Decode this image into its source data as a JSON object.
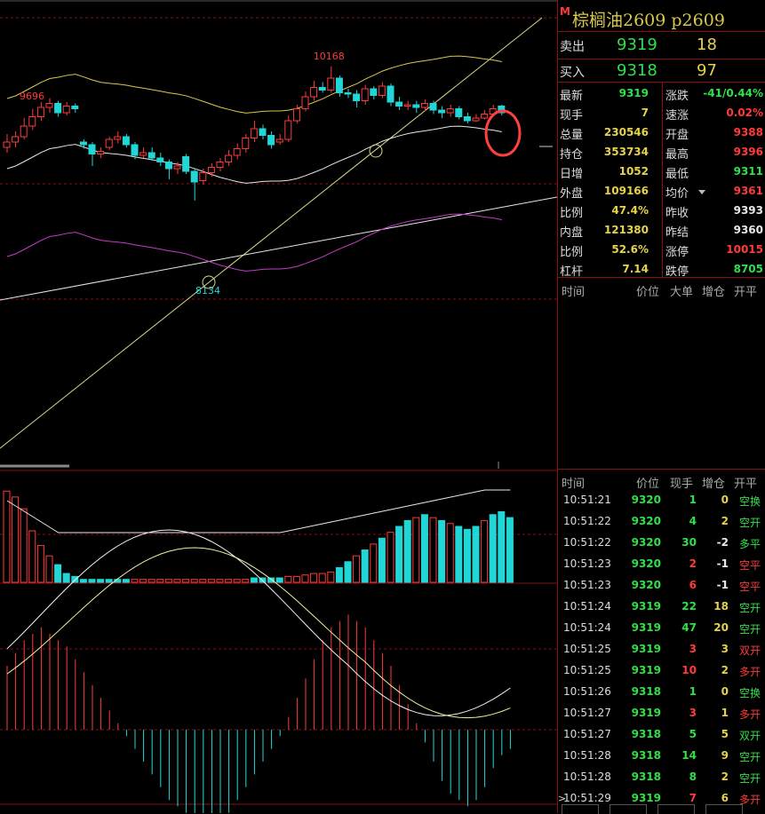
{
  "instrument": {
    "badge": "M",
    "title": "棕榈油2609  p2609"
  },
  "quote": {
    "sell_label": "卖出",
    "sell_price": "9319",
    "sell_vol": "18",
    "buy_label": "买入",
    "buy_price": "9318",
    "buy_vol": "97"
  },
  "stats": [
    {
      "l1": "最新",
      "v1": "9319",
      "c1": "green",
      "l2": "涨跌",
      "v2": "-41/0.44%",
      "c2": "green"
    },
    {
      "l1": "现手",
      "v1": "7",
      "c1": "yellow",
      "l2": "速涨",
      "v2": "0.02%",
      "c2": "red"
    },
    {
      "l1": "总量",
      "v1": "230546",
      "c1": "yellow",
      "l2": "开盘",
      "v2": "9388",
      "c2": "red"
    },
    {
      "l1": "持仓",
      "v1": "353734",
      "c1": "yellow",
      "l2": "最高",
      "v2": "9396",
      "c2": "red"
    },
    {
      "l1": "日增",
      "v1": "1052",
      "c1": "yellow",
      "l2": "最低",
      "v2": "9311",
      "c2": "green"
    },
    {
      "l1": "外盘",
      "v1": "109166",
      "c1": "yellow",
      "l2": "均价",
      "v2": "9361",
      "c2": "red"
    },
    {
      "l1": "比例",
      "v1": "47.4%",
      "c1": "yellow",
      "l2": "昨收",
      "v2": "9393",
      "c2": "white"
    },
    {
      "l1": "内盘",
      "v1": "121380",
      "c1": "yellow",
      "l2": "昨结",
      "v2": "9360",
      "c2": "white"
    },
    {
      "l1": "比例",
      "v1": "52.6%",
      "c1": "yellow",
      "l2": "涨停",
      "v2": "10015",
      "c2": "red"
    },
    {
      "l1": "杠杆",
      "v1": "7.14",
      "c1": "yellow",
      "l2": "跌停",
      "v2": "8705",
      "c2": "green"
    }
  ],
  "big_order_header": {
    "time": "时间",
    "price": "价位",
    "big": "大单",
    "oi": "增仓",
    "type": "开平"
  },
  "tick_header": {
    "time": "时间",
    "price": "价位",
    "vol": "现手",
    "oi": "增仓",
    "type": "开平"
  },
  "ticks": [
    {
      "time": "10:51:21",
      "price": "9320",
      "vol": "1",
      "oi": "0",
      "type": "空换",
      "pc": "green",
      "vc": "green",
      "oc": "yellow",
      "tc": "green"
    },
    {
      "time": "10:51:22",
      "price": "9320",
      "vol": "4",
      "oi": "2",
      "type": "空开",
      "pc": "green",
      "vc": "green",
      "oc": "yellow",
      "tc": "green"
    },
    {
      "time": "10:51:22",
      "price": "9320",
      "vol": "30",
      "oi": "-2",
      "type": "多平",
      "pc": "green",
      "vc": "green",
      "oc": "white",
      "tc": "green"
    },
    {
      "time": "10:51:23",
      "price": "9320",
      "vol": "2",
      "oi": "-1",
      "type": "空平",
      "pc": "green",
      "vc": "red",
      "oc": "white",
      "tc": "red"
    },
    {
      "time": "10:51:23",
      "price": "9320",
      "vol": "6",
      "oi": "-1",
      "type": "空平",
      "pc": "green",
      "vc": "red",
      "oc": "white",
      "tc": "red"
    },
    {
      "time": "10:51:24",
      "price": "9319",
      "vol": "22",
      "oi": "18",
      "type": "空开",
      "pc": "green",
      "vc": "green",
      "oc": "yellow",
      "tc": "green"
    },
    {
      "time": "10:51:24",
      "price": "9319",
      "vol": "47",
      "oi": "20",
      "type": "空开",
      "pc": "green",
      "vc": "green",
      "oc": "yellow",
      "tc": "green"
    },
    {
      "time": "10:51:25",
      "price": "9319",
      "vol": "3",
      "oi": "3",
      "type": "双开",
      "pc": "green",
      "vc": "red",
      "oc": "yellow",
      "tc": "red"
    },
    {
      "time": "10:51:25",
      "price": "9319",
      "vol": "10",
      "oi": "2",
      "type": "多开",
      "pc": "green",
      "vc": "red",
      "oc": "yellow",
      "tc": "red"
    },
    {
      "time": "10:51:26",
      "price": "9318",
      "vol": "1",
      "oi": "0",
      "type": "空换",
      "pc": "green",
      "vc": "green",
      "oc": "yellow",
      "tc": "green"
    },
    {
      "time": "10:51:27",
      "price": "9319",
      "vol": "3",
      "oi": "1",
      "type": "多开",
      "pc": "green",
      "vc": "red",
      "oc": "yellow",
      "tc": "red"
    },
    {
      "time": "10:51:27",
      "price": "9318",
      "vol": "5",
      "oi": "5",
      "type": "双开",
      "pc": "green",
      "vc": "green",
      "oc": "yellow",
      "tc": "green"
    },
    {
      "time": "10:51:28",
      "price": "9318",
      "vol": "14",
      "oi": "9",
      "type": "空开",
      "pc": "green",
      "vc": "green",
      "oc": "yellow",
      "tc": "green"
    },
    {
      "time": "10:51:28",
      "price": "9318",
      "vol": "8",
      "oi": "2",
      "type": "空开",
      "pc": "green",
      "vc": "green",
      "oc": "yellow",
      "tc": "green"
    },
    {
      "time": "10:51:29",
      "price": "9319",
      "vol": "7",
      "oi": "6",
      "type": "多开",
      "pc": "green",
      "vc": "red",
      "oc": "yellow",
      "tc": "red"
    }
  ],
  "colors": {
    "up": "#ff3a3a",
    "down": "#21d6d6",
    "grid": "#8a1010",
    "ma": "#e8e8e8",
    "boll_mid": "#d8c94a",
    "boll_low": "#c43cc4"
  },
  "chart_data": {
    "type": "candlestick",
    "annotations": {
      "high_label": "10168",
      "left_high_label": "9696",
      "low_label": "8134"
    },
    "candles": [
      {
        "o": 9560,
        "c": 9600,
        "h": 9660,
        "l": 9520
      },
      {
        "o": 9600,
        "c": 9640,
        "h": 9680,
        "l": 9560
      },
      {
        "o": 9640,
        "c": 9720,
        "h": 9780,
        "l": 9620
      },
      {
        "o": 9720,
        "c": 9790,
        "h": 9850,
        "l": 9690
      },
      {
        "o": 9790,
        "c": 9860,
        "h": 9900,
        "l": 9760
      },
      {
        "o": 9860,
        "c": 9890,
        "h": 9930,
        "l": 9820
      },
      {
        "o": 9890,
        "c": 9820,
        "h": 9910,
        "l": 9790
      },
      {
        "o": 9820,
        "c": 9870,
        "h": 9900,
        "l": 9800
      },
      {
        "o": 9870,
        "c": 9850,
        "h": 9890,
        "l": 9820
      },
      {
        "o": 9600,
        "c": 9580,
        "h": 9620,
        "l": 9550
      },
      {
        "o": 9580,
        "c": 9510,
        "h": 9600,
        "l": 9420
      },
      {
        "o": 9510,
        "c": 9530,
        "h": 9560,
        "l": 9480
      },
      {
        "o": 9560,
        "c": 9620,
        "h": 9640,
        "l": 9540
      },
      {
        "o": 9620,
        "c": 9640,
        "h": 9680,
        "l": 9590
      },
      {
        "o": 9640,
        "c": 9580,
        "h": 9660,
        "l": 9560
      },
      {
        "o": 9580,
        "c": 9500,
        "h": 9600,
        "l": 9470
      },
      {
        "o": 9500,
        "c": 9520,
        "h": 9560,
        "l": 9480
      },
      {
        "o": 9520,
        "c": 9480,
        "h": 9560,
        "l": 9460
      },
      {
        "o": 9480,
        "c": 9450,
        "h": 9520,
        "l": 9420
      },
      {
        "o": 9450,
        "c": 9400,
        "h": 9470,
        "l": 9320
      },
      {
        "o": 9400,
        "c": 9420,
        "h": 9450,
        "l": 9360
      },
      {
        "o": 9490,
        "c": 9380,
        "h": 9510,
        "l": 9360
      },
      {
        "o": 9380,
        "c": 9300,
        "h": 9400,
        "l": 9160
      },
      {
        "o": 9310,
        "c": 9370,
        "h": 9400,
        "l": 9280
      },
      {
        "o": 9370,
        "c": 9410,
        "h": 9440,
        "l": 9340
      },
      {
        "o": 9410,
        "c": 9450,
        "h": 9480,
        "l": 9380
      },
      {
        "o": 9450,
        "c": 9500,
        "h": 9540,
        "l": 9420
      },
      {
        "o": 9500,
        "c": 9550,
        "h": 9590,
        "l": 9470
      },
      {
        "o": 9550,
        "c": 9630,
        "h": 9660,
        "l": 9520
      },
      {
        "o": 9630,
        "c": 9700,
        "h": 9760,
        "l": 9600
      },
      {
        "o": 9700,
        "c": 9650,
        "h": 9730,
        "l": 9620
      },
      {
        "o": 9650,
        "c": 9580,
        "h": 9680,
        "l": 9550
      },
      {
        "o": 9600,
        "c": 9620,
        "h": 9660,
        "l": 9580
      },
      {
        "o": 9620,
        "c": 9760,
        "h": 9800,
        "l": 9600
      },
      {
        "o": 9760,
        "c": 9850,
        "h": 9880,
        "l": 9740
      },
      {
        "o": 9850,
        "c": 9940,
        "h": 9980,
        "l": 9830
      },
      {
        "o": 9940,
        "c": 10010,
        "h": 10060,
        "l": 9910
      },
      {
        "o": 10010,
        "c": 9990,
        "h": 10050,
        "l": 9970
      },
      {
        "o": 9990,
        "c": 10080,
        "h": 10168,
        "l": 9970
      },
      {
        "o": 10080,
        "c": 9970,
        "h": 10100,
        "l": 9940
      },
      {
        "o": 9970,
        "c": 9960,
        "h": 10000,
        "l": 9930
      },
      {
        "o": 9960,
        "c": 9910,
        "h": 9990,
        "l": 9860
      },
      {
        "o": 9910,
        "c": 10000,
        "h": 10030,
        "l": 9880
      },
      {
        "o": 10000,
        "c": 9950,
        "h": 10020,
        "l": 9920
      },
      {
        "o": 9950,
        "c": 10020,
        "h": 10050,
        "l": 9930
      },
      {
        "o": 10020,
        "c": 9900,
        "h": 10040,
        "l": 9870
      },
      {
        "o": 9900,
        "c": 9870,
        "h": 9940,
        "l": 9840
      },
      {
        "o": 9870,
        "c": 9880,
        "h": 9910,
        "l": 9840
      },
      {
        "o": 9880,
        "c": 9860,
        "h": 9910,
        "l": 9820
      },
      {
        "o": 9860,
        "c": 9890,
        "h": 9920,
        "l": 9830
      },
      {
        "o": 9890,
        "c": 9840,
        "h": 9910,
        "l": 9810
      },
      {
        "o": 9840,
        "c": 9820,
        "h": 9870,
        "l": 9780
      },
      {
        "o": 9820,
        "c": 9850,
        "h": 9880,
        "l": 9790
      },
      {
        "o": 9850,
        "c": 9790,
        "h": 9870,
        "l": 9770
      },
      {
        "o": 9790,
        "c": 9760,
        "h": 9820,
        "l": 9740
      },
      {
        "o": 9760,
        "c": 9780,
        "h": 9810,
        "l": 9750
      },
      {
        "o": 9780,
        "c": 9810,
        "h": 9840,
        "l": 9770
      },
      {
        "o": 9810,
        "c": 9850,
        "h": 9880,
        "l": 9800
      },
      {
        "o": 9870,
        "c": 9820,
        "h": 9880,
        "l": 9800
      }
    ],
    "volume": [
      62,
      58,
      50,
      35,
      25,
      18,
      12,
      6,
      4,
      2,
      2,
      2,
      2,
      2,
      2,
      2,
      2,
      2,
      2,
      2,
      2,
      2,
      2,
      2,
      2,
      2,
      2,
      2,
      2,
      3,
      3,
      3,
      3,
      4,
      4,
      5,
      6,
      6,
      7,
      10,
      14,
      18,
      22,
      26,
      30,
      34,
      38,
      42,
      44,
      46,
      44,
      42,
      40,
      38,
      36,
      38,
      42,
      46,
      48,
      44
    ],
    "volume_up": [
      true,
      true,
      true,
      true,
      true,
      true,
      false,
      false,
      false,
      false,
      false,
      false,
      false,
      false,
      false,
      true,
      true,
      true,
      true,
      true,
      true,
      true,
      true,
      true,
      true,
      true,
      true,
      true,
      true,
      false,
      false,
      false,
      false,
      true,
      true,
      true,
      true,
      true,
      true,
      false,
      false,
      true,
      false,
      true,
      false,
      true,
      false,
      false,
      true,
      false,
      true,
      false,
      true,
      false,
      false,
      false,
      true,
      false,
      false,
      false
    ],
    "macd": [
      20,
      24,
      28,
      30,
      32,
      30,
      28,
      26,
      22,
      18,
      14,
      10,
      6,
      2,
      -2,
      -6,
      -10,
      -14,
      -18,
      -22,
      -24,
      -26,
      -28,
      -30,
      -30,
      -28,
      -26,
      -22,
      -18,
      -14,
      -10,
      -6,
      -2,
      4,
      10,
      16,
      22,
      28,
      32,
      34,
      36,
      34,
      32,
      28,
      24,
      20,
      14,
      8,
      2,
      -4,
      -10,
      -16,
      -20,
      -22,
      -24,
      -22,
      -18,
      -12,
      -8,
      -6
    ]
  }
}
